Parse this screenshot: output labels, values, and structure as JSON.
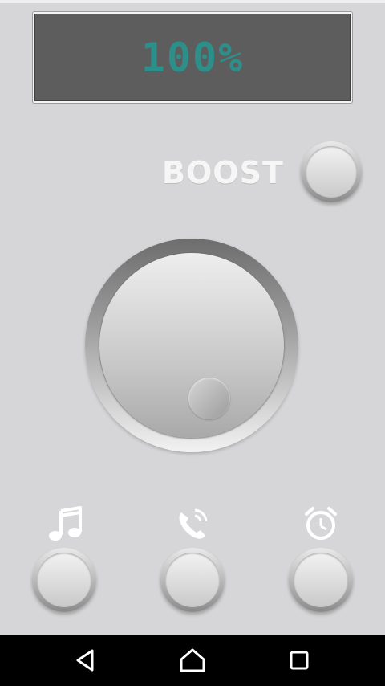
{
  "display": {
    "level_text": "100%"
  },
  "boost": {
    "label": "BOOST"
  },
  "volume_knob": {
    "level_percent": 100
  },
  "modes": [
    {
      "icon": "music-note-icon"
    },
    {
      "icon": "phone-call-icon"
    },
    {
      "icon": "alarm-clock-icon"
    }
  ],
  "navigation": {
    "back": "back-triangle-icon",
    "home": "home-icon",
    "recents": "recents-square-icon"
  },
  "colors": {
    "lcd_text": "#2d8f8a",
    "background": "#d6d6d8"
  }
}
